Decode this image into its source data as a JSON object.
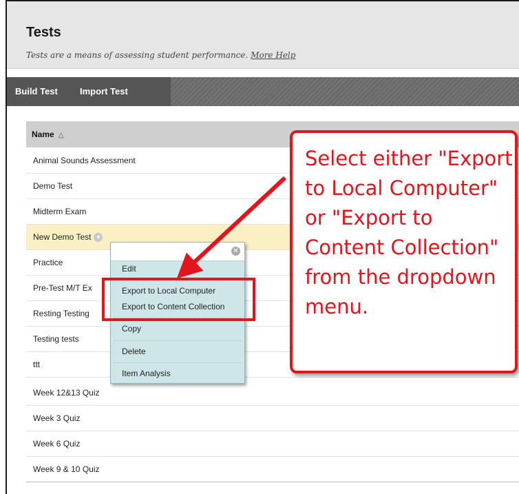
{
  "page": {
    "title": "Tests",
    "subtitle": "Tests are a means of assessing student performance.",
    "help_link": "More Help"
  },
  "action_bar": {
    "build_test": "Build Test",
    "import_test": "Import Test"
  },
  "table": {
    "column_name": "Name",
    "sort_icon": "sort-ascending-icon",
    "rows": [
      "Animal Sounds Assessment",
      "Demo Test",
      "Midterm Exam",
      "New Demo Test",
      "Practice",
      "Pre-Test M/T Ex",
      "Resting Testing",
      "Testing tests",
      "ttt",
      "Week 12&13 Quiz",
      "Week 3 Quiz",
      "Week 6 Quiz",
      "Week 9 & 10 Quiz"
    ]
  },
  "context_menu": {
    "items": [
      "Edit",
      "Export to Local Computer",
      "Export to Content Collection",
      "Copy",
      "Delete",
      "Item Analysis"
    ],
    "close_icon": "close-icon"
  },
  "callout": {
    "text": "Select either \"Export to Local Computer\" or \"Export to Content Collection\" from the dropdown menu."
  },
  "colors": {
    "annotation_red": "#e3141b",
    "menu_bg": "#cfe6e9",
    "highlight_row": "#fbf0c4",
    "action_bar": "#6a6a6a"
  }
}
